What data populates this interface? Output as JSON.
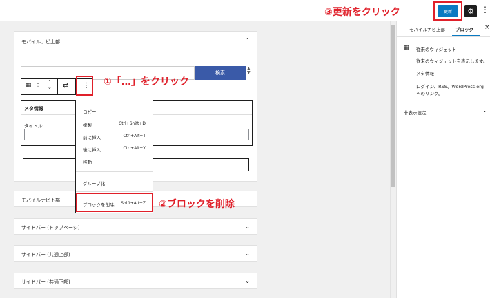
{
  "annotations": {
    "step1": "①「…」をクリック",
    "step2": "②ブロックを削除",
    "step3": "③更新をクリック"
  },
  "header": {
    "update_label": "更新",
    "settings_icon": "gear-icon",
    "options_icon": "more-vertical-icon"
  },
  "editor": {
    "panel_top_title": "モバイルナビ上部",
    "search_button_label": "検索",
    "meta_block_title": "メタ情報",
    "title_label": "タイトル:",
    "panels": [
      "モバイルナビ下部",
      "サイドバー (トップページ)",
      "サイドバー (共通上部)",
      "サイドバー (共通下部)"
    ]
  },
  "menu": {
    "items": [
      {
        "label": "コピー",
        "shortcut": ""
      },
      {
        "label": "複製",
        "shortcut": "Ctrl+Shift+D"
      },
      {
        "label": "前に挿入",
        "shortcut": "Ctrl+Alt+T"
      },
      {
        "label": "後に挿入",
        "shortcut": "Ctrl+Alt+Y"
      },
      {
        "label": "移動",
        "shortcut": ""
      }
    ],
    "group_label": "グループ化",
    "remove_label": "ブロックを削除",
    "remove_shortcut": "Shift+Alt+Z"
  },
  "sidebar": {
    "tab_area": "モバイルナビ上部",
    "tab_block": "ブロック",
    "close": "×",
    "widget_title": "従来のウィジェット",
    "widget_desc": "従来のウィジェットを表示します。",
    "meta_title": "メタ情報",
    "meta_desc_1": "ログイン、RSS、WordPress.org",
    "meta_desc_2": "へのリンク。",
    "hidden_settings": "非表示設定"
  },
  "colors": {
    "accent": "#0a7ac2",
    "annotation": "#e0202a",
    "search_button": "#3a5aa8"
  }
}
